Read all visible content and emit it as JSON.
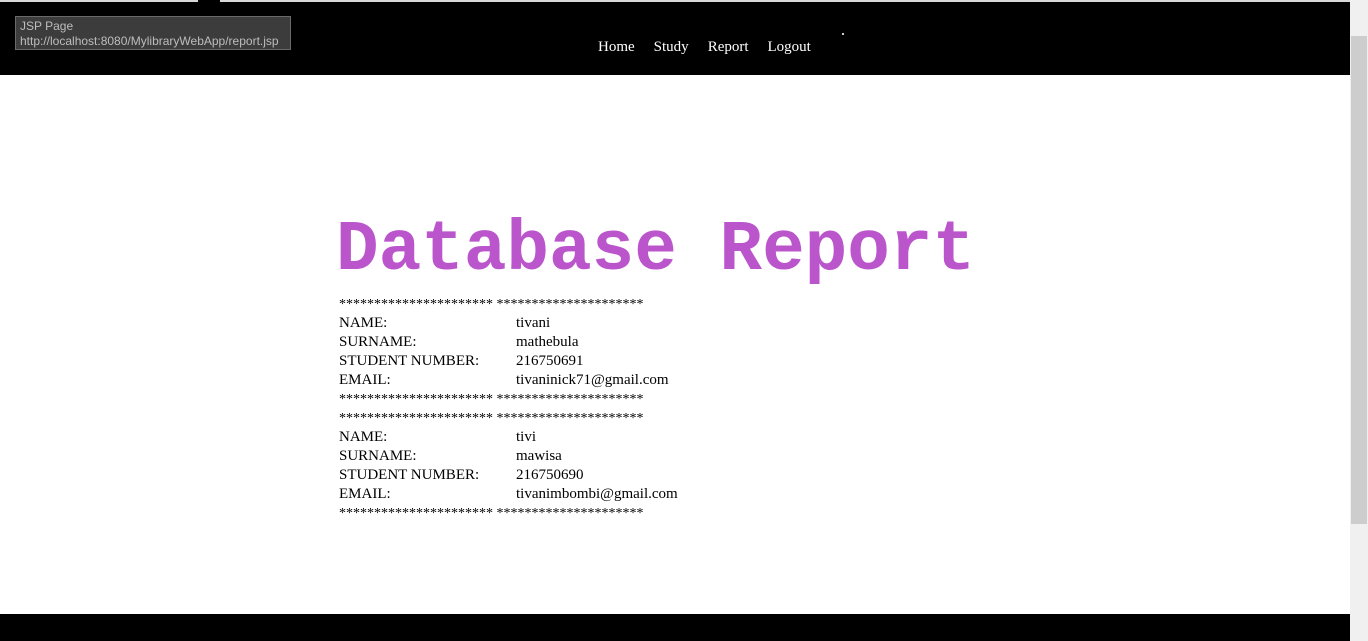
{
  "tooltip": {
    "title": "JSP Page",
    "url": "http://localhost:8080/MylibraryWebApp/report.jsp"
  },
  "nav": {
    "items": [
      "Home",
      "Study",
      "Report",
      "Logout"
    ]
  },
  "heading": "Database Report",
  "separator": "**********************  *********************",
  "labels": {
    "name": "NAME:",
    "surname": "SURNAME:",
    "student_number": "STUDENT NUMBER:",
    "email": "EMAIL:"
  },
  "records": [
    {
      "name": "tivani",
      "surname": "mathebula",
      "student_number": "216750691",
      "email": "tivaninick71@gmail.com"
    },
    {
      "name": "tivi",
      "surname": "mawisa",
      "student_number": "216750690",
      "email": "tivanimbombi@gmail.com"
    }
  ],
  "colors": {
    "heading": "#bb55cc",
    "navbar": "#000000"
  }
}
